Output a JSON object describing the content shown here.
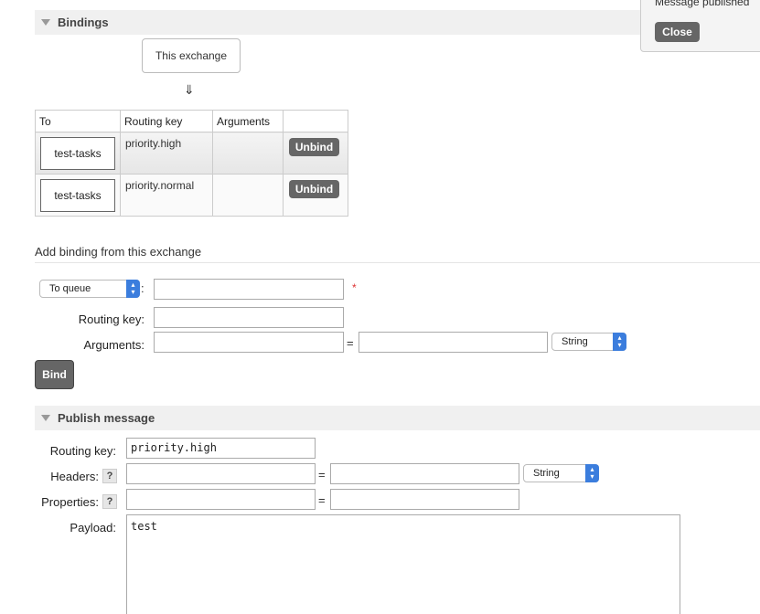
{
  "bindings_section": {
    "title": "Bindings",
    "exchange_label": "This exchange",
    "arrow": "⇓",
    "table": {
      "headers": [
        "To",
        "Routing key",
        "Arguments",
        ""
      ],
      "rows": [
        {
          "to": "test-tasks",
          "routing_key": "priority.high",
          "arguments": "",
          "action": "Unbind"
        },
        {
          "to": "test-tasks",
          "routing_key": "priority.normal",
          "arguments": "",
          "action": "Unbind"
        }
      ]
    }
  },
  "add_binding": {
    "heading": "Add binding from this exchange",
    "destination_type": "To queue",
    "destination_value": "",
    "required_marker": "*",
    "routing_key_label": "Routing key:",
    "routing_key_value": "",
    "arguments_label": "Arguments:",
    "argument_key": "",
    "argument_value": "",
    "argument_type": "String",
    "equals": "=",
    "colon": ":",
    "bind_label": "Bind"
  },
  "publish_section": {
    "title": "Publish message",
    "routing_key_label": "Routing key:",
    "routing_key_value": "priority.high",
    "headers_label": "Headers:",
    "header_key": "",
    "header_value": "",
    "header_type": "String",
    "properties_label": "Properties:",
    "property_key": "",
    "property_value": "",
    "help": "?",
    "equals": "=",
    "payload_label": "Payload:",
    "payload_value": "test"
  },
  "notification": {
    "message": "Message published",
    "close_label": "Close"
  },
  "icons": {
    "collapse": "triangle-down-icon",
    "select": "chevron-updown-icon"
  },
  "colors": {
    "button_bg": "#666666",
    "select_accent": "#3b7ddd",
    "section_header_bg": "#f0f0f0",
    "required": "#dd3333"
  }
}
